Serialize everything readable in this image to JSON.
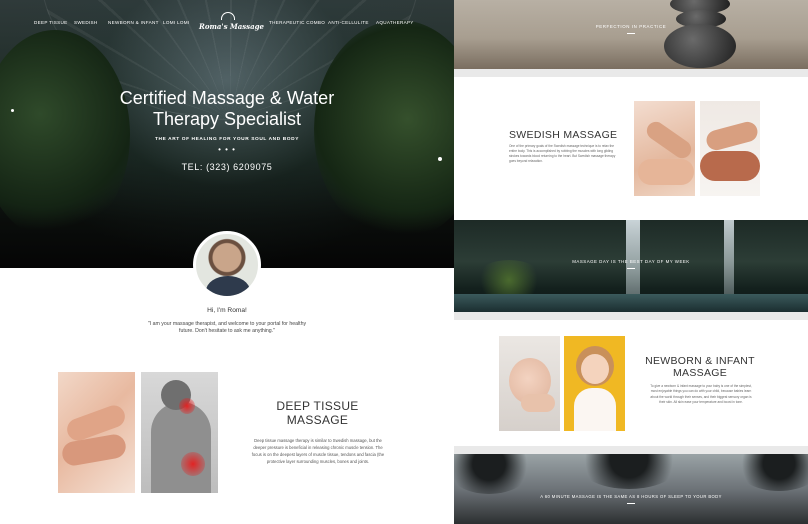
{
  "nav": {
    "items": [
      "DEEP TISSUE",
      "SWEDISH",
      "NEWBORN & INFANT",
      "LOMI LOMI",
      "THERAPEUTIC COMBO",
      "ANTI-CELLULITE",
      "AQUATHERAPY"
    ],
    "logo_text": "Roma's Massage"
  },
  "hero": {
    "title_line1": "Certified Massage & Water",
    "title_line2": "Therapy Specialist",
    "subtitle": "THE ART OF HEALING FOR YOUR SOUL AND BODY",
    "dots": "• • •",
    "phone": "TEL: (323) 6209075"
  },
  "intro": {
    "greeting": "Hi, I'm Roma!",
    "quote": "\"I am your massage therapist, and welcome to your portal for healthy future. Don't hesitate to ask me anything.\""
  },
  "deep_tissue": {
    "title_line1": "DEEP TISSUE",
    "title_line2": "MASSAGE",
    "text": "Deep tissue massage therapy is similar to Swedish massage, but the deeper pressure is beneficial in releasing chronic muscle tension. The focus is on the deepest layers of muscle tissue, tendons and fascia (the protective layer surrounding muscles, bones and joints."
  },
  "banners": {
    "stones_caption": "PERFECTION IN PRACTICE",
    "falls_caption": "MASSAGE DAY IS THE BEST DAY OF MY WEEK",
    "palms_caption": "A 60 MINUTE MASSAGE IS THE SAME AS 8 HOURS OF SLEEP TO YOUR BODY"
  },
  "swedish": {
    "title": "SWEDISH MASSAGE",
    "text": "One of the primary goals of the Swedish massage technique is to relax the entire body. This is accomplished by rubbing the muscles with long gliding strokes towards blood returning to the heart. But Swedish massage therapy goes beyond relaxation."
  },
  "newborn": {
    "title_line1": "NEWBORN & INFANT",
    "title_line2": "MASSAGE",
    "text": "To give a newborn & infant massage to your baby is one of the simplest, most enjoyable things you can do with your child, because babies learn about the world through their senses, and their biggest sensory organ is their skin. All skin ease your temperature and boost in tone."
  }
}
